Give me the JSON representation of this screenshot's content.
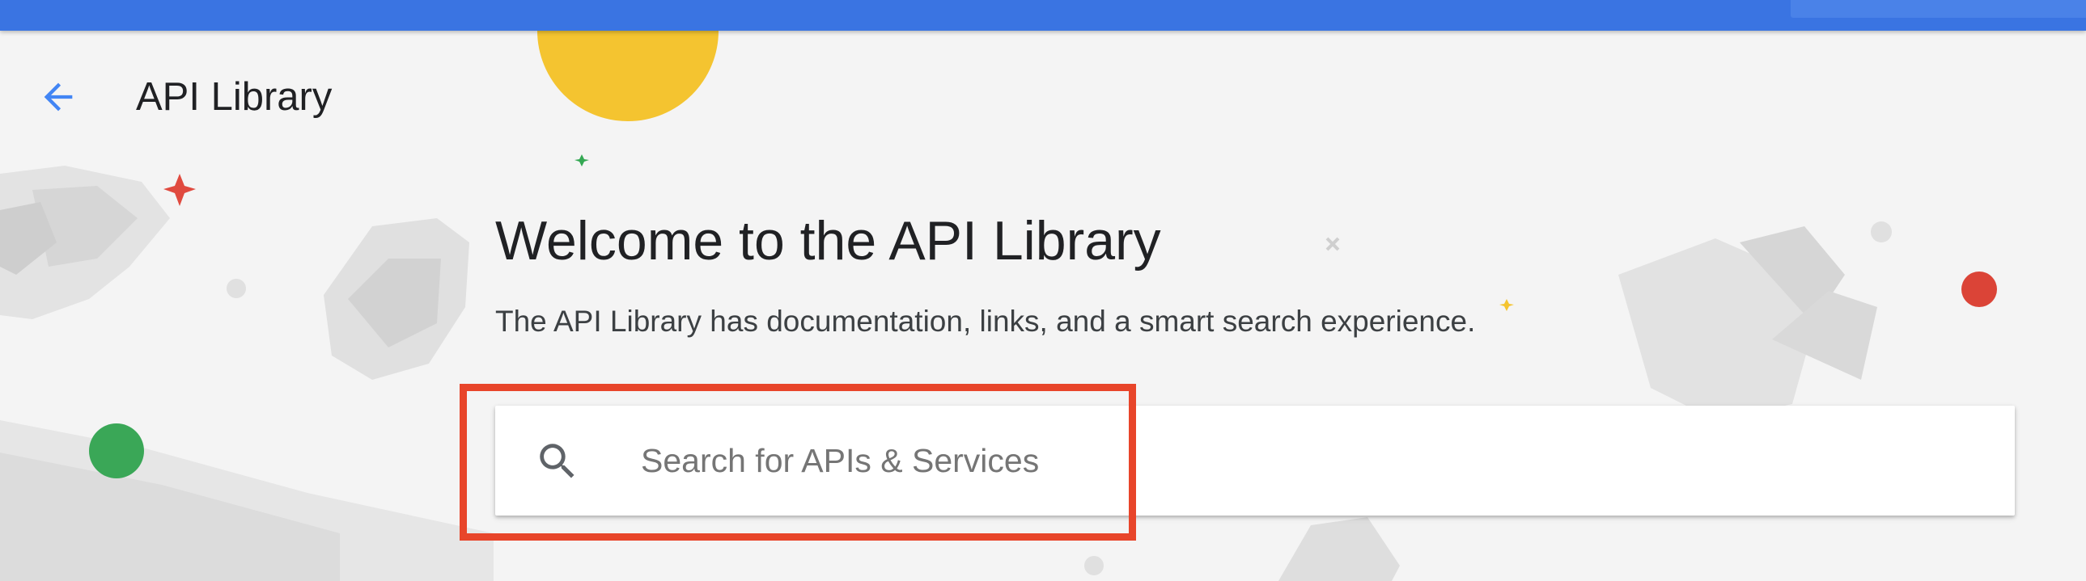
{
  "header": {
    "title": "API Library",
    "back_icon": "arrow-left-icon"
  },
  "welcome": {
    "heading": "Welcome to the API Library",
    "description": "The API Library has documentation, links, and a smart search experience."
  },
  "search": {
    "placeholder": "Search for APIs & Services",
    "value": "",
    "icon": "search-icon"
  },
  "annotation": {
    "highlight_color": "#e8452a",
    "target": "search-input"
  },
  "colors": {
    "topbar": "#3a74e2",
    "accent": "#4285f4",
    "background": "#f4f4f4"
  }
}
